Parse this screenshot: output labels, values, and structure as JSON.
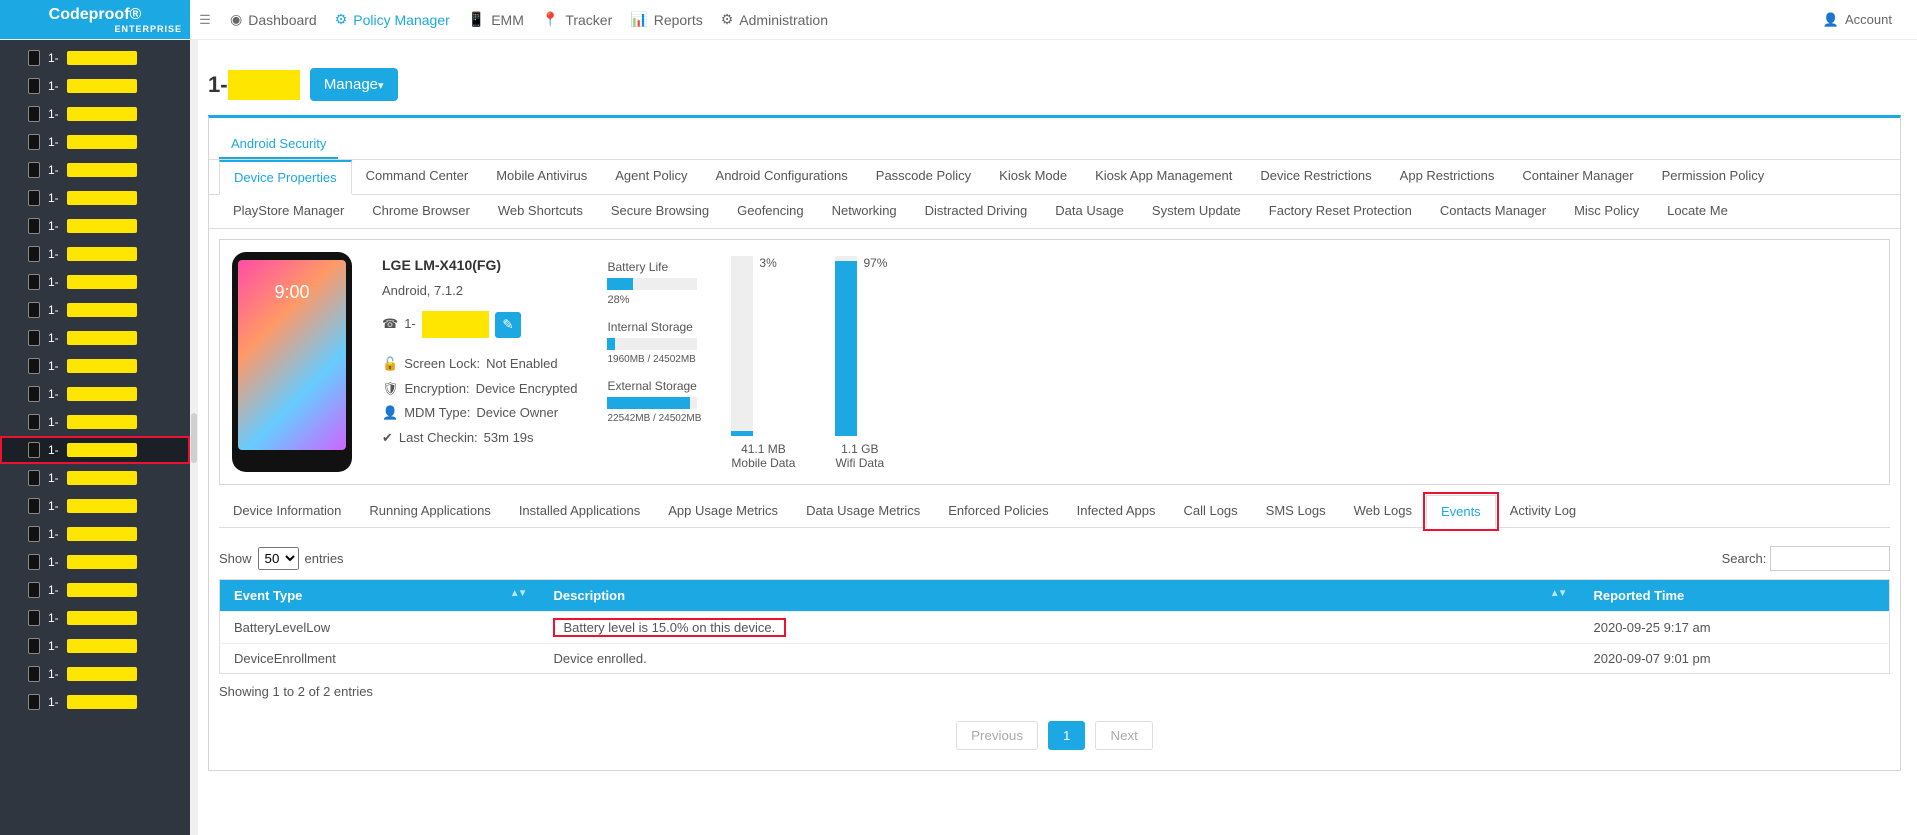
{
  "brand": {
    "title": "Codeproof®",
    "subtitle": "ENTERPRISE"
  },
  "nav": {
    "items": [
      "Dashboard",
      "Policy Manager",
      "EMM",
      "Tracker",
      "Reports",
      "Administration"
    ],
    "active_index": 1,
    "account": "Account"
  },
  "sidebar": {
    "prefix": "1-",
    "mask": "7",
    "count": 24,
    "selected_index": 14
  },
  "page": {
    "heading_prefix": "1-",
    "heading_mask": "7",
    "manage_btn": "Manage",
    "android_security_tab": "Android Security"
  },
  "policy_tabs_row1": [
    "Device Properties",
    "Command Center",
    "Mobile Antivirus",
    "Agent Policy",
    "Android Configurations",
    "Passcode Policy",
    "Kiosk Mode",
    "Kiosk App Management",
    "Device Restrictions",
    "App Restrictions",
    "Container Manager",
    "Permission Policy"
  ],
  "policy_tabs_row2": [
    "PlayStore Manager",
    "Chrome Browser",
    "Web Shortcuts",
    "Secure Browsing",
    "Geofencing",
    "Networking",
    "Distracted Driving",
    "Data Usage",
    "System Update",
    "Factory Reset Protection",
    "Contacts Manager",
    "Misc Policy",
    "Locate Me"
  ],
  "policy_tabs_active": "Device Properties",
  "device": {
    "model": "LGE LM-X410(FG)",
    "os": "Android, 7.1.2",
    "phone_prefix": "1-",
    "phone_mask": "7",
    "screen_lock_label": "Screen Lock:",
    "screen_lock_value": "Not Enabled",
    "encryption_label": "Encryption:",
    "encryption_value": "Device Encrypted",
    "mdm_label": "MDM Type:",
    "mdm_value": "Device Owner",
    "checkin_label": "Last Checkin:",
    "checkin_value": "53m 19s",
    "phone_time": "9:00"
  },
  "storage": {
    "battery_label": "Battery Life",
    "battery_pct": "28%",
    "battery_fill": 28,
    "internal_label": "Internal Storage",
    "internal_text": "1960MB / 24502MB",
    "internal_fill": 8,
    "external_label": "External Storage",
    "external_text": "22542MB / 24502MB",
    "external_fill": 92
  },
  "data_bars": {
    "mobile": {
      "label": "Mobile Data",
      "pct": "3%",
      "fill": 3,
      "value": "41.1 MB"
    },
    "wifi": {
      "label": "Wifi Data",
      "pct": "97%",
      "fill": 97,
      "value": "1.1 GB"
    }
  },
  "detail_tabs": [
    "Device Information",
    "Running Applications",
    "Installed Applications",
    "App Usage Metrics",
    "Data Usage Metrics",
    "Enforced Policies",
    "Infected Apps",
    "Call Logs",
    "SMS Logs",
    "Web Logs",
    "Events",
    "Activity Log"
  ],
  "detail_tabs_active": "Events",
  "table": {
    "show_label": "Show",
    "entries_label": "entries",
    "page_size": "50",
    "search_label": "Search:",
    "columns": [
      "Event Type",
      "Description",
      "Reported Time"
    ],
    "rows": [
      {
        "type": "BatteryLevelLow",
        "desc": "Battery level is 15.0% on this device.",
        "time": "2020-09-25 9:17 am",
        "highlight": true
      },
      {
        "type": "DeviceEnrollment",
        "desc": "Device enrolled.",
        "time": "2020-09-07 9:01 pm",
        "highlight": false
      }
    ],
    "info": "Showing 1 to 2 of 2 entries",
    "pager": {
      "previous": "Previous",
      "next": "Next",
      "current": "1"
    }
  }
}
